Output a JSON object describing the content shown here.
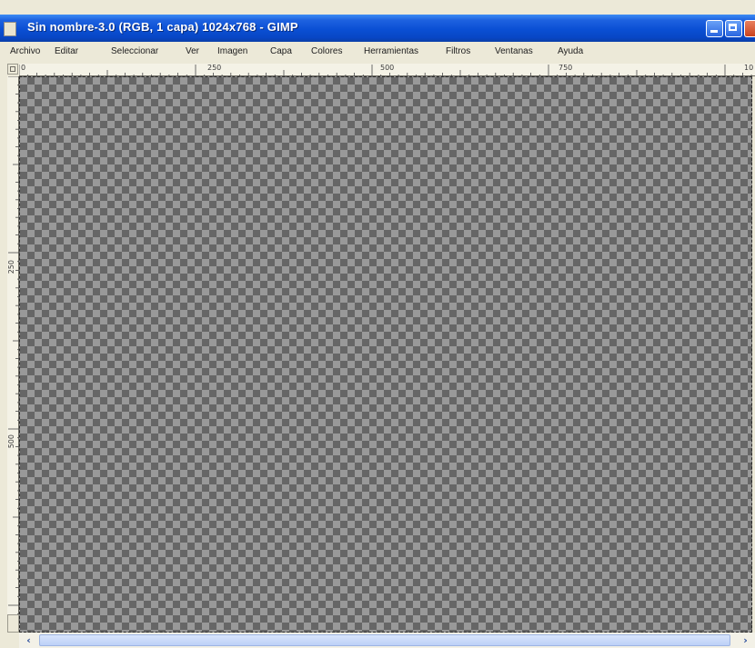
{
  "window": {
    "title": "Sin nombre-3.0 (RGB, 1 capa) 1024x768 - GIMP"
  },
  "menu": {
    "items": [
      {
        "label": "Archivo"
      },
      {
        "label": "Editar"
      },
      {
        "label": "Seleccionar"
      },
      {
        "label": "Ver"
      },
      {
        "label": "Imagen"
      },
      {
        "label": "Capa"
      },
      {
        "label": "Colores"
      },
      {
        "label": "Herramientas"
      },
      {
        "label": "Filtros"
      },
      {
        "label": "Ventanas"
      },
      {
        "label": "Ayuda"
      }
    ]
  },
  "ruler": {
    "h_labels": [
      "0",
      "250",
      "500",
      "750",
      "10"
    ],
    "v_labels": [
      "250",
      "500"
    ]
  },
  "scrollbar": {
    "left_arrow": "‹",
    "right_arrow": "›"
  },
  "icons": {
    "app": "gimp-app-icon",
    "minimize": "minimize-icon",
    "maximize": "maximize-icon",
    "close": "close-icon",
    "quickmask": "quick-mask-icon",
    "navigate": "navigate-icon"
  },
  "colors": {
    "titlebar": "#0a4fd4",
    "checker_light": "#999999",
    "checker_dark": "#666666",
    "menubar": "#ece9d8"
  }
}
